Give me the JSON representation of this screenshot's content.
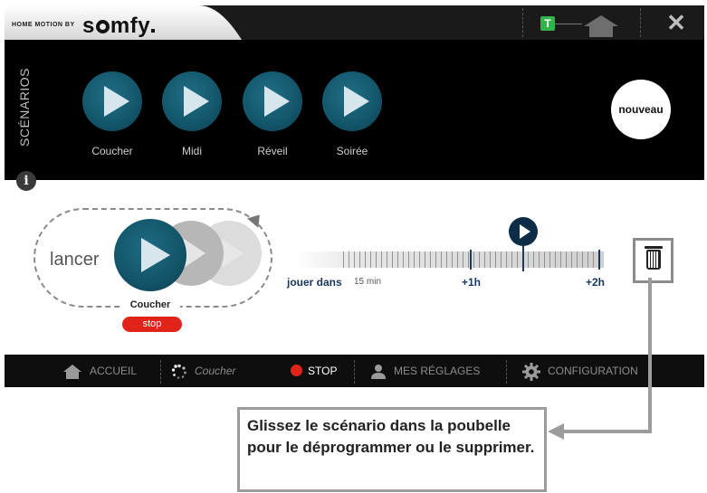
{
  "brand": {
    "prefix": "HOME MOTION BY",
    "logo": "somfy"
  },
  "titlebar": {
    "t_badge": "T",
    "close_glyph": "✕"
  },
  "scenarios": {
    "section_label": "SCÉNARIOS",
    "items": [
      {
        "label": "Coucher",
        "icon": "play-icon"
      },
      {
        "label": "Midi",
        "icon": "play-icon"
      },
      {
        "label": "Réveil",
        "icon": "play-icon"
      },
      {
        "label": "Soirée",
        "icon": "play-icon"
      }
    ],
    "new_label": "nouveau"
  },
  "launch": {
    "lancer_label": "lancer",
    "scenario_name": "Coucher",
    "stop_label": "stop"
  },
  "timeline": {
    "jouer_dans": "jouer dans",
    "min_label": "15 min",
    "h1_label": "+1h",
    "h2_label": "+2h",
    "cursor_position_fraction": 0.75
  },
  "bottombar": {
    "accueil": "ACCUEIL",
    "current": "Coucher",
    "stop": "STOP",
    "reglages": "MES RÉGLAGES",
    "configuration": "CONFIGURATION"
  },
  "callout": {
    "text": "Glissez le scénario dans la poubelle pour le déprogrammer ou le supprimer."
  },
  "colors": {
    "accent_blue": "#14586d",
    "stop_red": "#e2231a",
    "t_badge_green": "#36b24a",
    "label_navy": "#17375e"
  }
}
